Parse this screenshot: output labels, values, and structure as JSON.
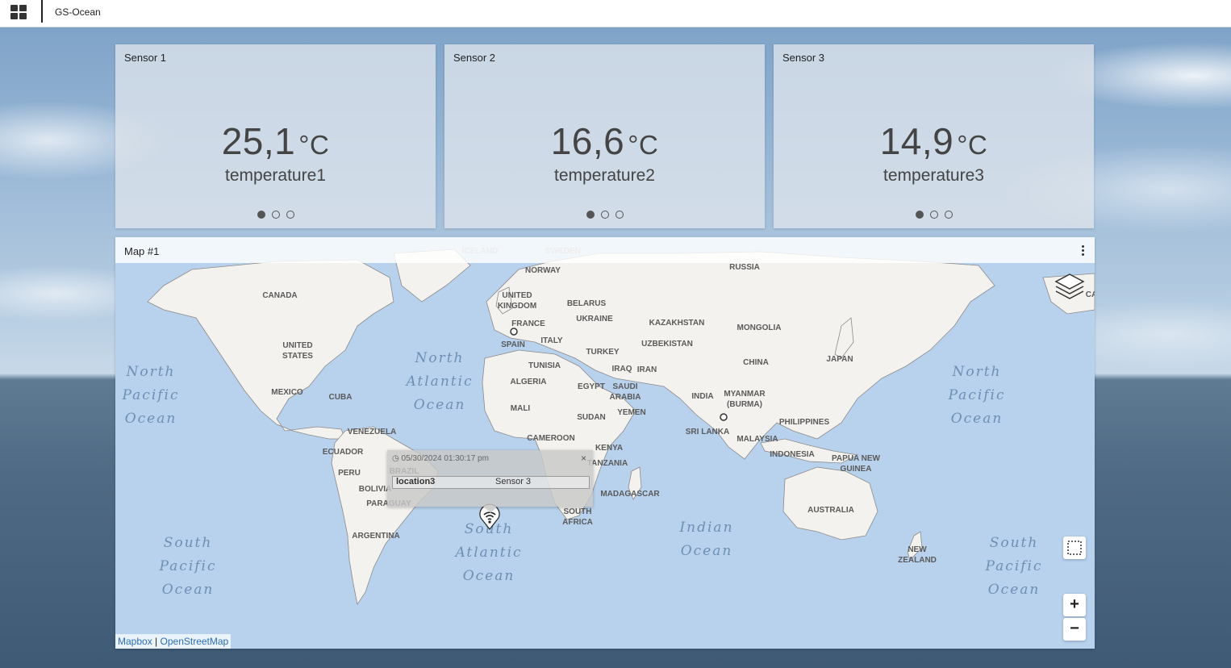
{
  "app": {
    "title": "GS-Ocean"
  },
  "sensors": [
    {
      "title": "Sensor 1",
      "value": "25,1",
      "unit": "°C",
      "label": "temperature1",
      "pages": 3,
      "active_page": 0
    },
    {
      "title": "Sensor 2",
      "value": "16,6",
      "unit": "°C",
      "label": "temperature2",
      "pages": 3,
      "active_page": 0
    },
    {
      "title": "Sensor 3",
      "value": "14,9",
      "unit": "°C",
      "label": "temperature3",
      "pages": 3,
      "active_page": 0
    }
  ],
  "map": {
    "title": "Map #1",
    "labels": {
      "countries": [
        "ICELAND",
        "SWEDEN",
        "NORWAY",
        "RUSSIA",
        "CANADA",
        "UNITED",
        "KINGDOM",
        "BELARUS",
        "UKRAINE",
        "FRANCE",
        "KAZAKHSTAN",
        "MONGOLIA",
        "UNITED",
        "STATES",
        "SPAIN",
        "ITALY",
        "UZBEKISTAN",
        "TURKEY",
        "JAPAN",
        "CHINA",
        "TUNISIA",
        "IRAQ",
        "IRAN",
        "MEXICO",
        "CUBA",
        "ALGERIA",
        "EGYPT",
        "SAUDI",
        "ARABIA",
        "INDIA",
        "MYANMAR",
        "(BURMA)",
        "MALI",
        "SUDAN",
        "YEMEN",
        "PHILIPPINES",
        "VENEZUELA",
        "SRI LANKA",
        "CAMEROON",
        "MALAYSIA",
        "ECUADOR",
        "KENYA",
        "INDONESIA",
        "PAPUA NEW",
        "GUINEA",
        "PERU",
        "BRAZIL",
        "TANZANIA",
        "BOLIVIA",
        "MADAGASCAR",
        "PARAGUAY",
        "AUSTRALIA",
        "SOUTH",
        "AFRICA",
        "ARGENTINA",
        "NEW",
        "ZEALAND",
        "CA"
      ],
      "oceans": [
        [
          "North",
          "Pacific",
          "Ocean"
        ],
        [
          "North",
          "Atlantic",
          "Ocean"
        ],
        [
          "North",
          "Pacific",
          "Ocean"
        ],
        [
          "South",
          "Atlantic",
          "Ocean"
        ],
        [
          "Indian",
          "Ocean"
        ],
        [
          "South",
          "Pacific",
          "Ocean"
        ],
        [
          "South",
          "Pacific",
          "Ocean"
        ]
      ]
    },
    "popup": {
      "timestamp": "05/30/2024 01:30:17 pm",
      "key": "location3",
      "value": "Sensor 3"
    },
    "controls": {
      "zoom_in": "+",
      "zoom_out": "−"
    },
    "attribution": {
      "mapbox": "Mapbox",
      "separator": "|",
      "osm": "OpenStreetMap"
    }
  },
  "icons": [
    "apps-grid-icon",
    "kebab-menu-icon",
    "layers-icon",
    "box-select-icon",
    "wifi-marker-icon",
    "clock-icon",
    "close-icon"
  ],
  "colors": {
    "water": "#b8d2ee",
    "land": "#f4f2ee",
    "border": "#555555"
  }
}
